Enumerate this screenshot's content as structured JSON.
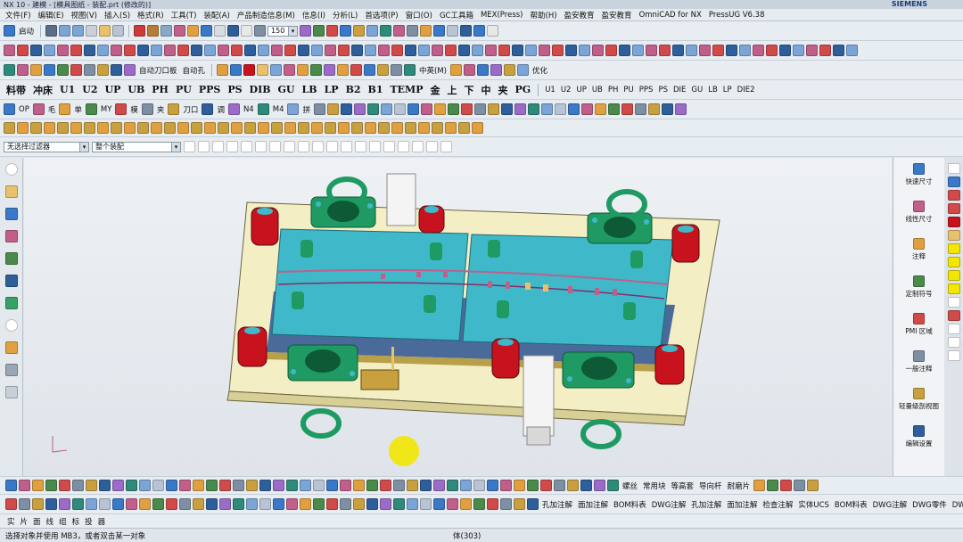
{
  "window": {
    "title": "NX 10 - 建模 - [模具图纸 - 装配.prt (修改的)]",
    "brand": "SIEMENS"
  },
  "menu": [
    "文件(F)",
    "编辑(E)",
    "视图(V)",
    "插入(S)",
    "格式(R)",
    "工具(T)",
    "装配(A)",
    "产品制造信息(M)",
    "信息(I)",
    "分析(L)",
    "首选项(P)",
    "窗口(O)",
    "GC工具箱",
    "MEX(Press)",
    "帮助(H)",
    "盈安教育",
    "盈安教育",
    "OmniCAD for NX",
    "PressUG V6.38"
  ],
  "toolbar1": {
    "start": "启动",
    "zoom": "150"
  },
  "toolbar3": {
    "chinese_label": "中英(M)",
    "optimize": "优化",
    "auto_punch": "自动刀口板",
    "auto_hole": "自动孔"
  },
  "toolbar4": {
    "labels": [
      "料带",
      "冲床",
      "U1",
      "U2",
      "UP",
      "UB",
      "PH",
      "PU",
      "PPS",
      "PS",
      "DIB",
      "GU",
      "LB",
      "LP",
      "B2",
      "B1",
      "TEMP",
      "金",
      "上",
      "下",
      "中",
      "夹",
      "PG"
    ],
    "right_labels": [
      "U1",
      "U2",
      "UP",
      "UB",
      "PH",
      "PU",
      "PPS",
      "PS",
      "DIE",
      "GU",
      "LB",
      "LP",
      "DIE2"
    ]
  },
  "toolbar5": {
    "labels": [
      "OP",
      "毛",
      "单",
      "MY",
      "模",
      "夹",
      "刀口",
      "调",
      "N4",
      "M4",
      "拼"
    ]
  },
  "filter": {
    "selection_filter": "无选择过滤器",
    "assembly": "整个装配"
  },
  "right_panel": [
    {
      "label": "快速尺寸",
      "icon": "rapid-dimension-icon"
    },
    {
      "label": "线性尺寸",
      "icon": "linear-dimension-icon"
    },
    {
      "label": "注释",
      "icon": "note-icon"
    },
    {
      "label": "定制符号",
      "icon": "custom-symbol-icon"
    },
    {
      "label": "PMI 区域",
      "icon": "pmi-region-icon"
    },
    {
      "label": "一般注释",
      "icon": "general-note-icon"
    },
    {
      "label": "轻量级剖视图",
      "icon": "lightweight-section-icon"
    },
    {
      "label": "编辑设置",
      "icon": "edit-settings-icon"
    }
  ],
  "bottom_toolbar1": {
    "labels": [
      "螺丝",
      "常用块",
      "等高套",
      "导向杆",
      "耐磨片"
    ]
  },
  "bottom_toolbar2": {
    "labels": [
      "孔加注解",
      "面加注解",
      "BOM料表",
      "DWG注解",
      "孔加注解",
      "面加注解",
      "检查注解",
      "实体UCS",
      "BOM料表",
      "DWG注解",
      "DWG零件",
      "DWG零件",
      "BOM加工"
    ],
    "left_labels": [
      "实",
      "片",
      "面",
      "线",
      "组",
      "标",
      "投",
      "器"
    ]
  },
  "status": {
    "message": "选择对象并使用 MB3，或者双击某一对象",
    "body_count": "体(303)"
  },
  "colors": {
    "die_plate": "#3fb9c9",
    "base_plate": "#f4eec4",
    "guide_post": "#c8121e",
    "lifting_ring": "#1f9a63",
    "yellow_cursor": "#f3e600"
  }
}
